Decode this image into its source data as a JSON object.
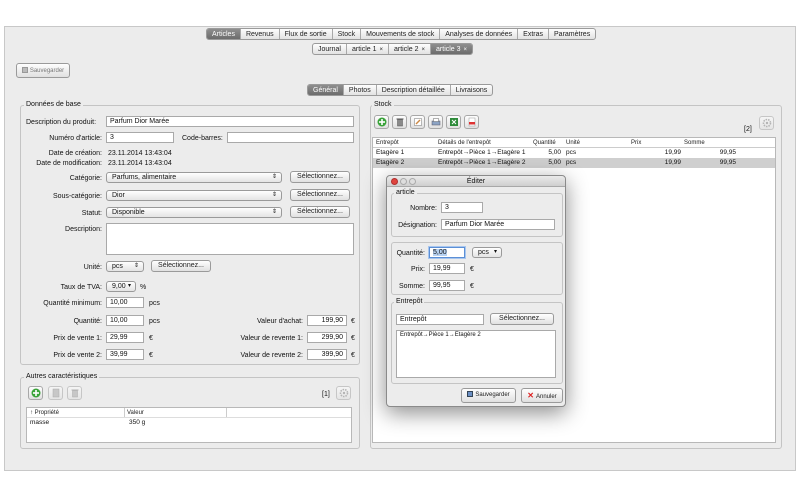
{
  "colors": {
    "selected_tab": "#7a7a7a",
    "selected_row": "#cfcfcf",
    "close_red": "#e0443e",
    "minimize_yellow": "#dedede",
    "zoom_green": "#dedede"
  },
  "top_tabs": [
    "Articles",
    "Revenus",
    "Flux de sortie",
    "Stock",
    "Mouvements de stock",
    "Analyses de données",
    "Extras",
    "Paramètres"
  ],
  "doc_tabs": [
    {
      "label": "Journal",
      "close": ""
    },
    {
      "label": "article 1",
      "close": "×"
    },
    {
      "label": "article 2",
      "close": "×"
    },
    {
      "label": "article 3",
      "close": "×"
    }
  ],
  "save_button": "Sauvegarder",
  "sub_tabs": [
    "Général",
    "Photos",
    "Description détaillée",
    "Livraisons"
  ],
  "base": {
    "title": "Données de base",
    "desc_label": "Description du produit:",
    "desc_value": "Parfum Dior Marée",
    "num_label": "Numéro d'article:",
    "num_value": "3",
    "barcode_label": "Code-barres:",
    "barcode_value": "",
    "created_label": "Date de création:",
    "created_value": "23.11.2014  13:43:04",
    "modified_label": "Date de modification:",
    "modified_value": "23.11.2014  13:43:04",
    "category_label": "Catégorie:",
    "category_value": "Parfums, alimentaire",
    "subcategory_label": "Sous-catégorie:",
    "subcategory_value": "Dior",
    "status_label": "Statut:",
    "status_value": "Disponible",
    "select_btn": "Sélectionnez...",
    "description_label": "Description:",
    "description_value": "",
    "unit_label": "Unité:",
    "unit_value": "pcs",
    "vat_label": "Taux de TVA:",
    "vat_value": "9,00",
    "vat_unit": "%",
    "minqty_label": "Quantité minimum:",
    "minqty_value": "10,00",
    "minqty_unit": "pcs",
    "qty_label": "Quantité:",
    "qty_value": "10,00",
    "qty_unit": "pcs",
    "price1_label": "Prix de vente 1:",
    "price1_value": "29,99",
    "price2_label": "Prix de vente 2:",
    "price2_value": "39,99",
    "currency": "€",
    "purchase_label": "Valeur d'achat:",
    "purchase_value": "199,90",
    "resale1_label": "Valeur de revente 1:",
    "resale1_value": "299,90",
    "resale2_label": "Valeur de revente 2:",
    "resale2_value": "399,90"
  },
  "other": {
    "title": "Autres caractéristiques",
    "count": "[1]",
    "col_property": "↑ Propriété",
    "col_value": "Valeur",
    "rows": [
      {
        "property": "masse",
        "value": "350 g"
      }
    ]
  },
  "stock": {
    "title": "Stock",
    "count": "[2]",
    "columns": [
      "Entrepôt",
      "Détails de l'entrepôt",
      "Quantité",
      "Unité",
      "Prix",
      "Somme"
    ],
    "rows": [
      {
        "entrepot": "Etagère 1",
        "details": "Entrepôt→Pièce 1→Etagère 1",
        "qty": "5,00",
        "unit": "pcs",
        "price": "19,99",
        "sum": "99,95"
      },
      {
        "entrepot": "Etagère 2",
        "details": "Entrepôt→Pièce 1→Etagère 2",
        "qty": "5,00",
        "unit": "pcs",
        "price": "19,99",
        "sum": "99,95"
      }
    ]
  },
  "dialog": {
    "title": "Éditer",
    "article_group": "article",
    "number_label": "Nombre:",
    "number_value": "3",
    "designation_label": "Désignation:",
    "designation_value": "Parfum Dior Marée",
    "qty_label": "Quantité:",
    "qty_value": "5,00",
    "unit_value": "pcs",
    "price_label": "Prix:",
    "price_value": "19,99",
    "sum_label": "Somme:",
    "sum_value": "99,95",
    "currency": "€",
    "warehouse_group": "Entrepôt",
    "warehouse_value": "Entrepôt",
    "select_btn": "Sélectionnez...",
    "path_value": "Entrepôt→Pièce 1→Etagère 2",
    "save_btn": "Sauvegarder",
    "cancel_btn": "Annuler"
  }
}
